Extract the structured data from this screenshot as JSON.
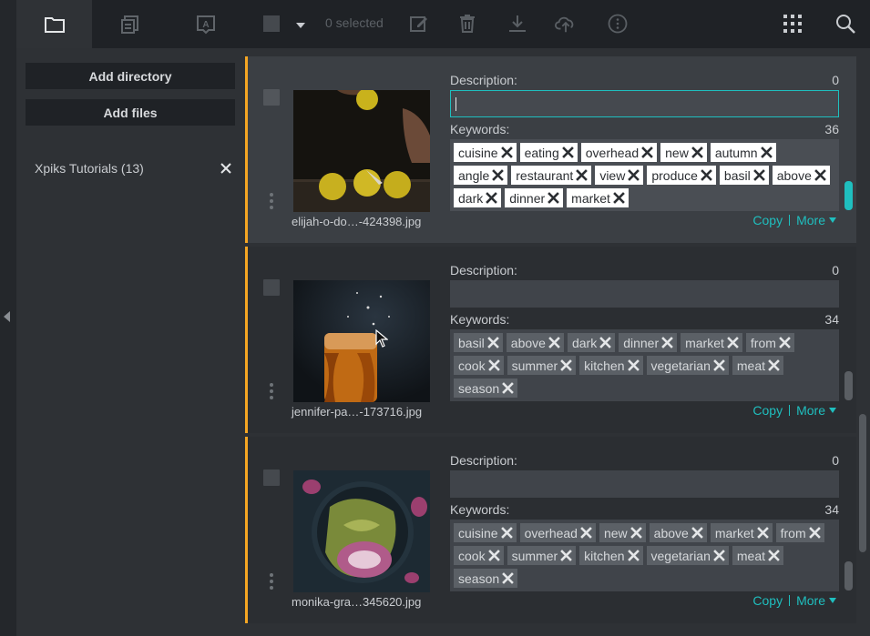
{
  "toolbar": {
    "tabs": [
      {
        "name": "folder-tab",
        "icon": "folder-icon",
        "active": true
      },
      {
        "name": "files-tab",
        "icon": "stacked-files-icon",
        "active": false
      },
      {
        "name": "spellcheck-tab",
        "icon": "text-box-icon",
        "active": false
      }
    ],
    "selected_label": "0 selected",
    "actions": [
      "edit-icon",
      "trash-icon",
      "download-icon",
      "upload-cloud-icon",
      "info-icon"
    ],
    "right_icons": [
      "grid-icon",
      "search-icon"
    ]
  },
  "sidebar": {
    "add_directory_label": "Add directory",
    "add_files_label": "Add files",
    "directories": [
      {
        "label": "Xpiks Tutorials (13)"
      }
    ]
  },
  "artworks": [
    {
      "filename": "elijah-o-do…-424398.jpg",
      "description_label": "Description:",
      "description_count": "0",
      "description_value": "",
      "keywords_label": "Keywords:",
      "keywords_count": "36",
      "keywords": [
        "cuisine",
        "eating",
        "overhead",
        "new",
        "autumn",
        "angle",
        "restaurant",
        "view",
        "produce",
        "basil",
        "above",
        "dark",
        "dinner",
        "market"
      ],
      "copy_label": "Copy",
      "more_label": "More",
      "selected": true
    },
    {
      "filename": "jennifer-pa…-173716.jpg",
      "description_label": "Description:",
      "description_count": "0",
      "description_value": "",
      "keywords_label": "Keywords:",
      "keywords_count": "34",
      "keywords": [
        "basil",
        "above",
        "dark",
        "dinner",
        "market",
        "from",
        "cook",
        "summer",
        "kitchen",
        "vegetarian",
        "meat",
        "season"
      ],
      "copy_label": "Copy",
      "more_label": "More",
      "selected": false
    },
    {
      "filename": "monika-gra…345620.jpg",
      "description_label": "Description:",
      "description_count": "0",
      "description_value": "",
      "keywords_label": "Keywords:",
      "keywords_count": "34",
      "keywords": [
        "cuisine",
        "overhead",
        "new",
        "above",
        "market",
        "from",
        "cook",
        "summer",
        "kitchen",
        "vegetarian",
        "meat",
        "season"
      ],
      "copy_label": "Copy",
      "more_label": "More",
      "selected": false
    }
  ],
  "colors": {
    "accent": "#1fbfbf",
    "card_marker": "#f5a623",
    "sidebar_bg": "#2e3135",
    "toolbar_bg": "#1f2226"
  }
}
